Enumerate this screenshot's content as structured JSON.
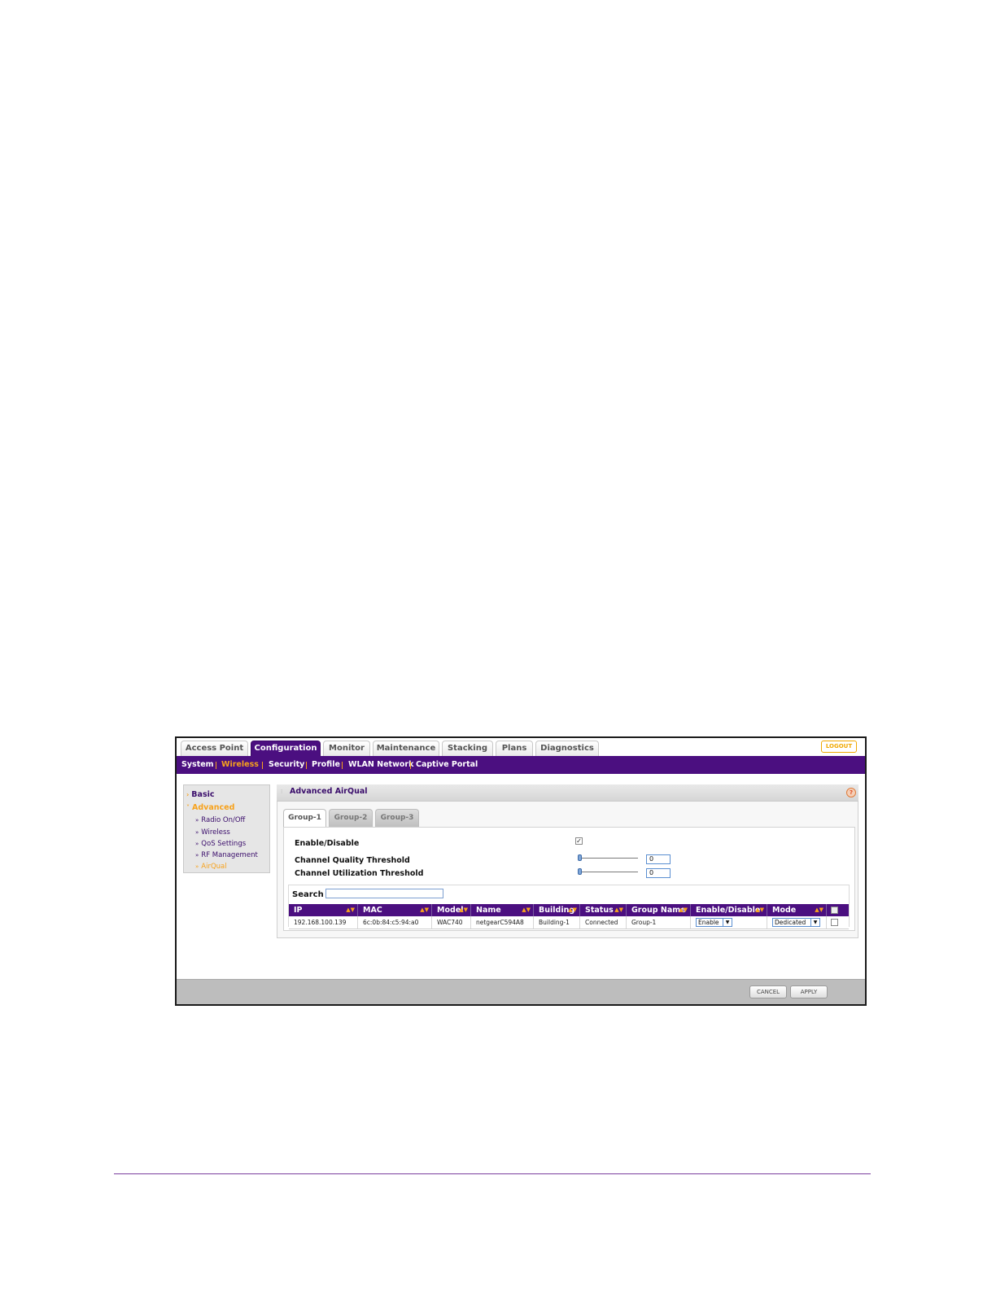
{
  "top_tabs": [
    "Access Point",
    "Configuration",
    "Monitor",
    "Maintenance",
    "Stacking",
    "Plans",
    "Diagnostics"
  ],
  "logout_label": "LOGOUT",
  "sub_nav": [
    "System",
    "Wireless",
    "Security",
    "Profile",
    "WLAN Network",
    "Captive Portal"
  ],
  "sidebar": {
    "basic": "Basic",
    "advanced": "Advanced",
    "items": [
      "Radio On/Off",
      "Wireless",
      "QoS Settings",
      "RF Management",
      "AirQual"
    ]
  },
  "content": {
    "title": "Advanced AirQual",
    "group_tabs": [
      "Group-1",
      "Group-2",
      "Group-3"
    ],
    "enable_label": "Enable/Disable",
    "cq_label": "Channel Quality Threshold",
    "cu_label": "Channel Utilization Threshold",
    "cq_value": "0",
    "cu_value": "0",
    "search_label": "Search",
    "search_value": ""
  },
  "table": {
    "headers": [
      "IP",
      "MAC",
      "Model",
      "Name",
      "Building",
      "Status",
      "Group Name",
      "Enable/Disable",
      "Mode"
    ],
    "row": [
      "192.168.100.139",
      "6c:0b:84:c5:94:a0",
      "WAC740",
      "netgearC594A8",
      "Building-1",
      "Connected",
      "Group-1",
      "Enable",
      "Dedicated"
    ]
  },
  "footer": {
    "cancel": "CANCEL",
    "apply": "APPLY"
  },
  "colors": {
    "brand_purple": "#4b0f80",
    "accent_orange": "#f7a21c"
  }
}
